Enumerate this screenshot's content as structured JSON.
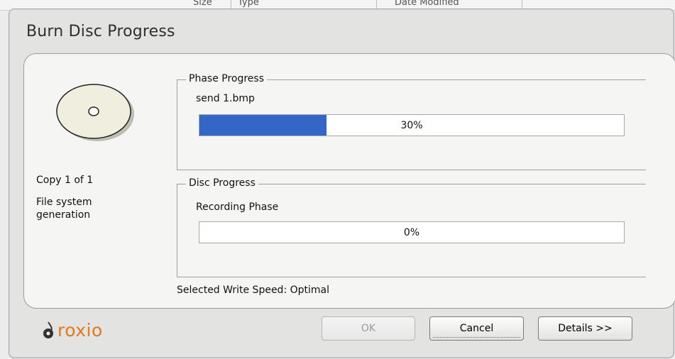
{
  "background": {
    "header_fragments": [
      "Size",
      "Type",
      "Date Modified"
    ]
  },
  "dialog": {
    "title": "Burn Disc Progress",
    "copy_status": "Copy 1 of 1",
    "phase_status": "File system generation",
    "phase_group": {
      "legend": "Phase Progress",
      "item": "send 1.bmp",
      "percent_label": "30%",
      "progress": 0.3
    },
    "disc_group": {
      "legend": "Disc Progress",
      "item": "Recording Phase",
      "percent_label": "0%",
      "progress": 0.0
    },
    "write_speed": "Selected Write Speed: Optimal"
  },
  "branding": {
    "logo_text": "roxio",
    "logo_icon": "roxio-flame-icon"
  },
  "buttons": {
    "ok": "OK",
    "cancel": "Cancel",
    "details": "Details >>"
  },
  "colors": {
    "progress_fill": "#3466c7",
    "brand": "#e27a1c"
  },
  "icons": {
    "disc": "disc-icon"
  }
}
